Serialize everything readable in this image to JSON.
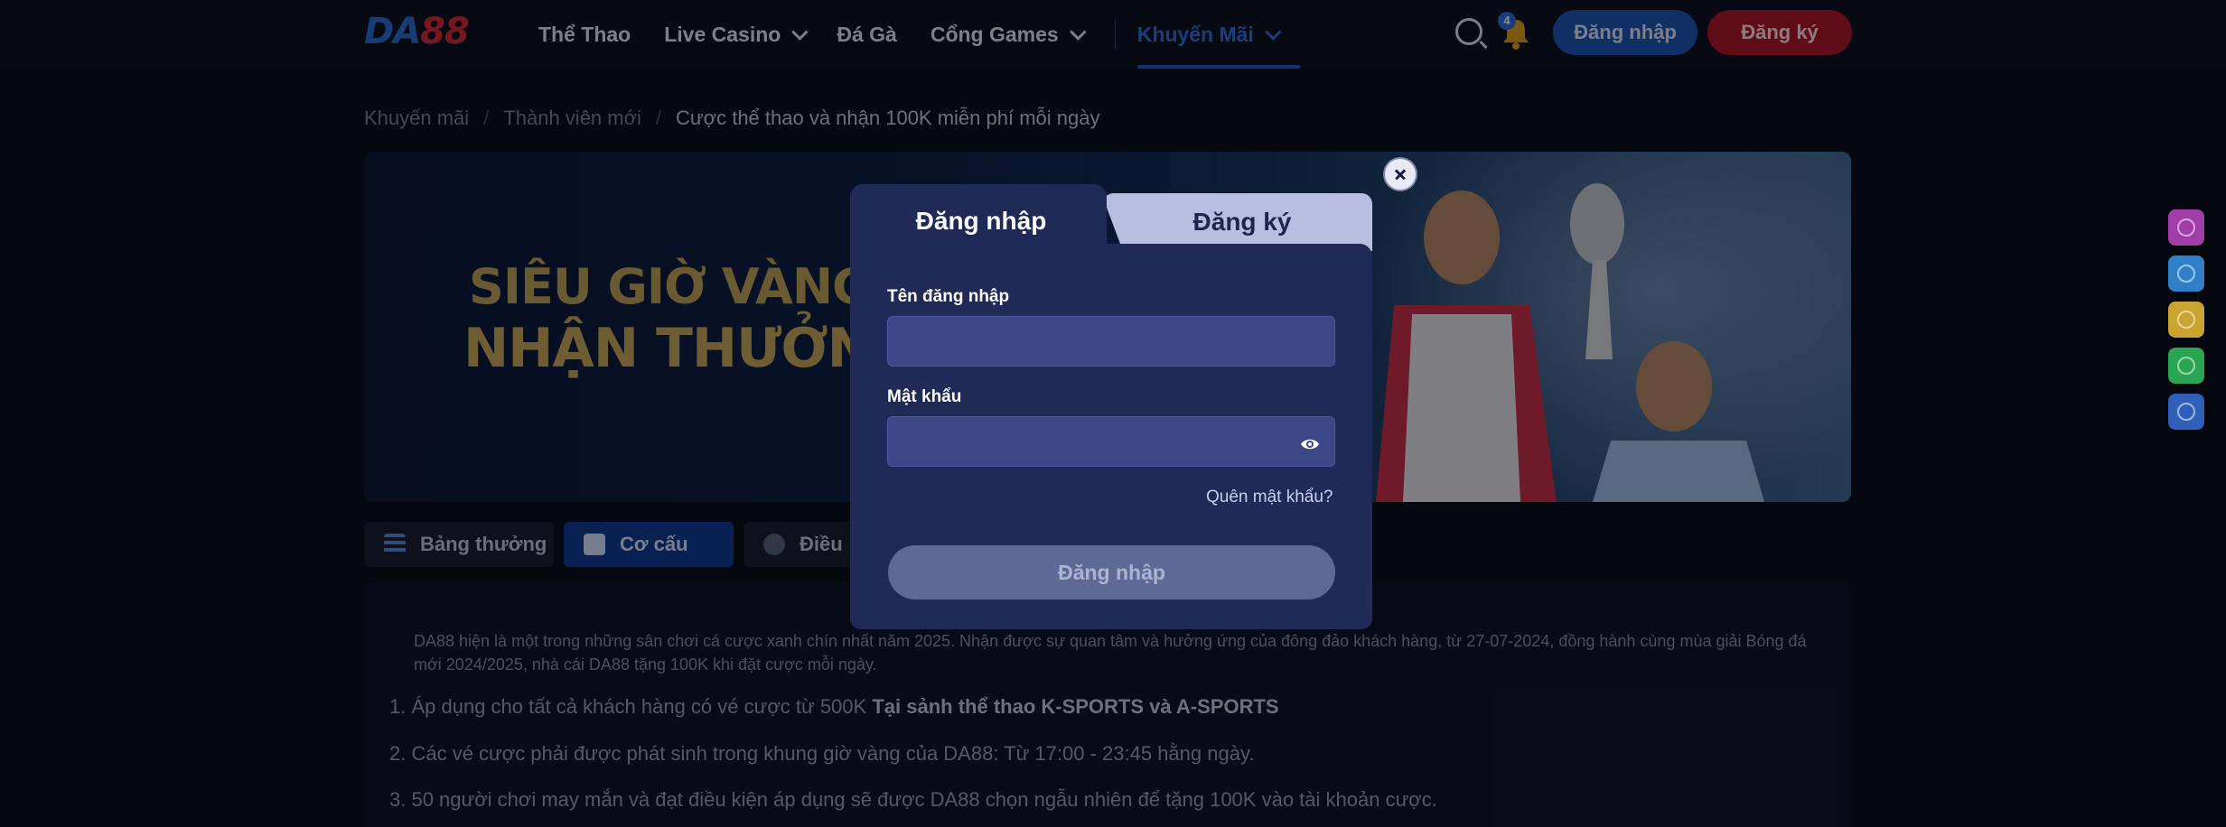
{
  "header": {
    "logo_da": "DA",
    "logo_88": "88",
    "nav": [
      {
        "label": "Thể Thao"
      },
      {
        "label": "Live Casino"
      },
      {
        "label": "Đá Gà"
      },
      {
        "label": "Cổng Games"
      },
      {
        "label": "Khuyến Mãi"
      }
    ],
    "notification_count": "4",
    "login_label": "Đăng nhập",
    "register_label": "Đăng ký"
  },
  "breadcrumb": [
    "Khuyến mãi",
    "Thành viên mới",
    "Cược thể thao và nhận 100K miễn phí mỗi ngày"
  ],
  "banner": {
    "line1": "SIÊU GIỜ VÀNG ĐẶ",
    "line2": "NHẬN THƯỞNG"
  },
  "promo_tabs": [
    "Bảng thưởng",
    "Cơ cấu",
    "Điều"
  ],
  "content": {
    "intro": "DA88 hiện là một trong những sân chơi cá cược xanh chín nhất năm 2025. Nhận được sự quan tâm và hưởng ứng của đông đảo khách hàng, từ 27-07-2024, đồng hành cùng mùa giải Bóng đá mới 2024/2025, nhà cái DA88 tặng 100K khi đặt cược mỗi ngày.",
    "rule1_prefix": "1. Áp dụng cho tất cả khách hàng có vé cược từ 500K",
    "rule1_bold": "Tại sảnh thể thao K-SPORTS và A-SPORTS",
    "rule2": "2. Các vé cược phải được phát sinh trong khung giờ vàng của DA88: Từ 17:00 - 23:45 hằng ngày.",
    "rule3": "3. 50 người chơi may mắn và đạt điều kiện áp dụng sẽ được DA88 chọn ngẫu nhiên để tặng 100K vào tài khoản cược."
  },
  "modal": {
    "tab_login": "Đăng nhập",
    "tab_register": "Đăng ký",
    "username_label": "Tên đăng nhập",
    "username_value": "",
    "password_label": "Mật khẩu",
    "password_value": "",
    "forgot_label": "Quên mật khẩu?",
    "submit_label": "Đăng nhập"
  },
  "colors": {
    "background": "#0b0f1e",
    "modal": "#1f2a56",
    "input": "#3b4786",
    "accent_blue": "#1e56b8",
    "accent_red": "#b0162c",
    "banner_gold": "#c2a45a"
  },
  "side_icons": [
    "chat-icon",
    "telegram-icon",
    "robot-icon",
    "phone-icon",
    "facebook-icon"
  ]
}
